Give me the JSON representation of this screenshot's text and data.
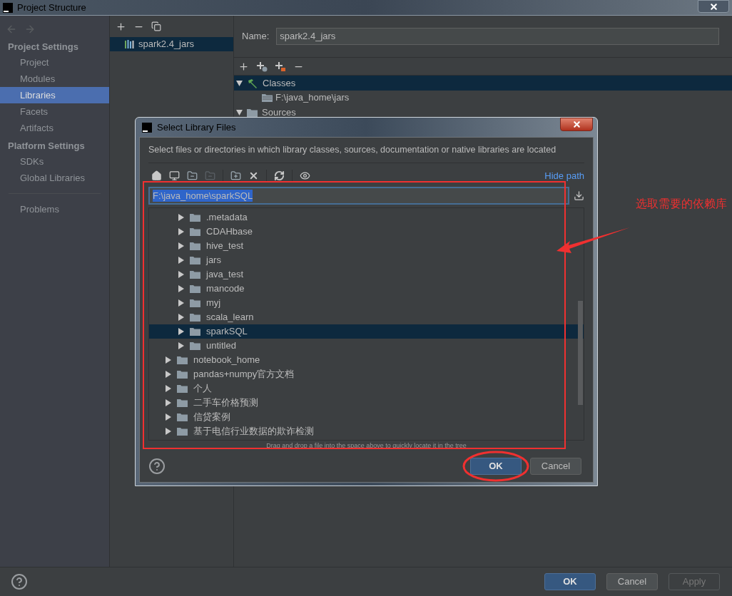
{
  "window": {
    "title": "Project Structure"
  },
  "sidebar": {
    "sections": [
      {
        "heading": "Project Settings",
        "items": [
          {
            "label": "Project",
            "selected": false
          },
          {
            "label": "Modules",
            "selected": false
          },
          {
            "label": "Libraries",
            "selected": true
          },
          {
            "label": "Facets",
            "selected": false
          },
          {
            "label": "Artifacts",
            "selected": false
          }
        ]
      },
      {
        "heading": "Platform Settings",
        "items": [
          {
            "label": "SDKs",
            "selected": false
          },
          {
            "label": "Global Libraries",
            "selected": false
          }
        ]
      }
    ],
    "extra_items": [
      {
        "label": "Problems",
        "selected": false
      }
    ]
  },
  "libraries": [
    {
      "label": "spark2.4_jars",
      "selected": true
    }
  ],
  "details": {
    "name_label": "Name:",
    "name_value": "spark2.4_jars",
    "roots": [
      {
        "label": "Classes",
        "selected": true,
        "children": [
          {
            "label": "F:\\java_home\\jars"
          }
        ]
      },
      {
        "label": "Sources",
        "selected": false
      }
    ]
  },
  "dialog": {
    "title": "Select Library Files",
    "description": "Select files or directories in which library classes, sources, documentation or native libraries are located",
    "hide_path": "Hide path",
    "path": "F:\\java_home\\sparkSQL",
    "tree": [
      {
        "children": [
          {
            "label": ".metadata",
            "selected": false
          },
          {
            "label": "CDAHbase",
            "selected": false
          },
          {
            "label": "hive_test",
            "selected": false
          },
          {
            "label": "jars",
            "selected": false
          },
          {
            "label": "java_test",
            "selected": false
          },
          {
            "label": "mancode",
            "selected": false
          },
          {
            "label": "myj",
            "selected": false
          },
          {
            "label": "scala_learn",
            "selected": false
          },
          {
            "label": "sparkSQL",
            "selected": true
          },
          {
            "label": "untitled",
            "selected": false
          }
        ]
      },
      {
        "label": "notebook_home",
        "selected": false
      },
      {
        "label": "pandas+numpy官方文档",
        "selected": false
      },
      {
        "label": "个人",
        "selected": false
      },
      {
        "label": "二手车价格预测",
        "selected": false
      },
      {
        "label": "信贷案例",
        "selected": false
      },
      {
        "label": "基于电信行业数据的欺诈检测",
        "selected": false
      }
    ],
    "hint": "Drag and drop a file into the space above to quickly locate it in the tree",
    "buttons": [
      {
        "label": "OK",
        "kind": "primary"
      },
      {
        "label": "Cancel",
        "kind": "normal"
      }
    ]
  },
  "buttons": [
    {
      "label": "OK",
      "kind": "primary"
    },
    {
      "label": "Cancel",
      "kind": "normal"
    },
    {
      "label": "Apply",
      "kind": "disabled"
    }
  ],
  "annotation": {
    "note": "选取需要的依赖库"
  }
}
